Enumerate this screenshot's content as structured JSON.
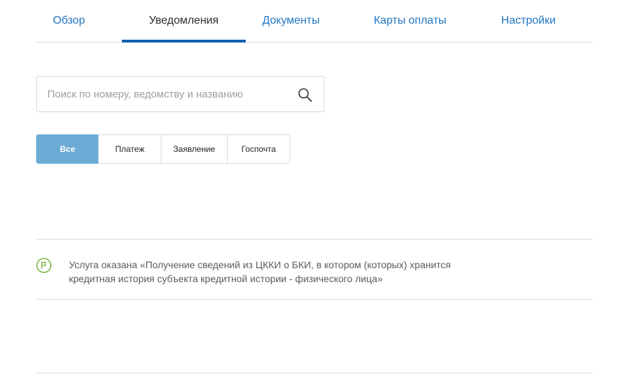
{
  "tabs": [
    {
      "label": "Обзор",
      "active": false
    },
    {
      "label": "Уведомления",
      "active": true
    },
    {
      "label": "Документы",
      "active": false
    },
    {
      "label": "Карты оплаты",
      "active": false
    },
    {
      "label": "Настройки",
      "active": false
    }
  ],
  "search": {
    "placeholder": "Поиск по номеру, ведомству и названию",
    "value": "",
    "icon": "search-icon"
  },
  "filters": [
    {
      "label": "Все",
      "active": true
    },
    {
      "label": "Платеж",
      "active": false
    },
    {
      "label": "Заявление",
      "active": false
    },
    {
      "label": "Госпочта",
      "active": false
    }
  ],
  "notifications": [
    {
      "icon": "flag-icon",
      "text": "Услуга оказана «Получение сведений из ЦККИ о БКИ, в котором (которых) хранится кредитная история субъекта кредитной истории - физического лица»"
    }
  ],
  "colors": {
    "accent": "#1f76c2",
    "tab_underline": "#0d5fb0",
    "filter_active": "#6aaad4",
    "flag_icon": "#7cb342"
  }
}
